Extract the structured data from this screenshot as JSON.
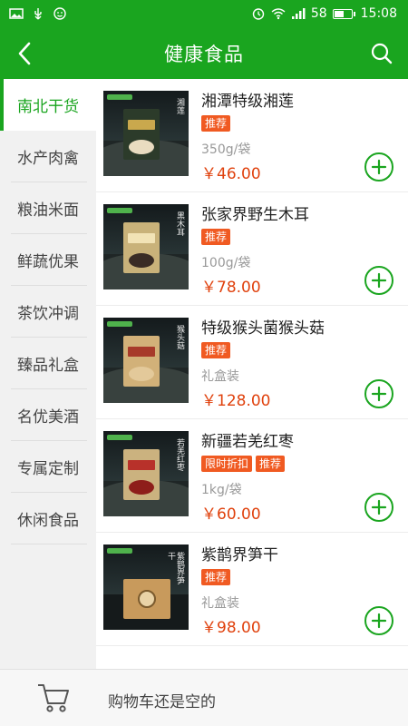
{
  "status_bar": {
    "signal_strength": "58",
    "battery_level": 0.58,
    "time": "15:08"
  },
  "app_bar": {
    "title": "健康食品"
  },
  "categories": [
    {
      "label": "南北干货",
      "active": true
    },
    {
      "label": "水产肉禽",
      "active": false
    },
    {
      "label": "粮油米面",
      "active": false
    },
    {
      "label": "鲜蔬优果",
      "active": false
    },
    {
      "label": "茶饮冲调",
      "active": false
    },
    {
      "label": "臻品礼盒",
      "active": false
    },
    {
      "label": "名优美酒",
      "active": false
    },
    {
      "label": "专属定制",
      "active": false
    },
    {
      "label": "休闲食品",
      "active": false
    }
  ],
  "products": [
    {
      "name": "湘潭特级湘莲",
      "tags": [
        "推荐"
      ],
      "spec": "350g/袋",
      "price": "￥46.00",
      "thumb_text": "湘莲"
    },
    {
      "name": "张家界野生木耳",
      "tags": [
        "推荐"
      ],
      "spec": "100g/袋",
      "price": "￥78.00",
      "thumb_text": "黑木耳"
    },
    {
      "name": "特级猴头菌猴头菇",
      "tags": [
        "推荐"
      ],
      "spec": "礼盒装",
      "price": "￥128.00",
      "thumb_text": "猴头菇"
    },
    {
      "name": "新疆若羌红枣",
      "tags": [
        "限时折扣",
        "推荐"
      ],
      "spec": "1kg/袋",
      "price": "￥60.00",
      "thumb_text": "若羌红枣"
    },
    {
      "name": "紫鹊界笋干",
      "tags": [
        "推荐"
      ],
      "spec": "礼盒装",
      "price": "￥98.00",
      "thumb_text": "紫鹊界笋干"
    }
  ],
  "cart": {
    "empty_text": "购物车还是空的"
  },
  "colors": {
    "brand_green": "#1aa51f",
    "price_red": "#e0420e",
    "tag_orange": "#f05a22"
  }
}
